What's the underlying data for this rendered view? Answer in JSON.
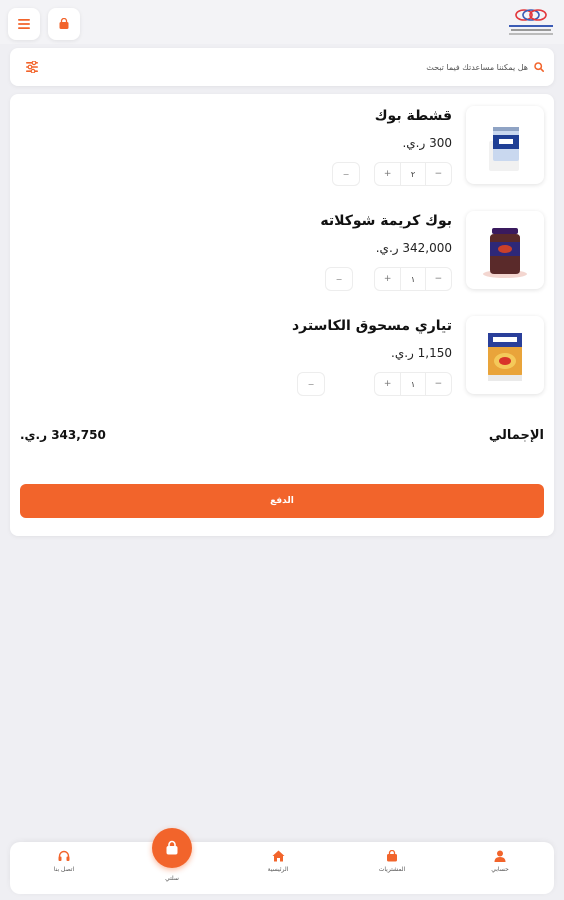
{
  "colors": {
    "accent": "#f2642b",
    "background": "#efeff3",
    "card": "#ffffff"
  },
  "header": {
    "menu_icon": "hamburger-icon",
    "cart_icon": "shopping-bag-icon",
    "logo_icon": "company-logo"
  },
  "search": {
    "placeholder": "هل يمكننا مساعدتك فيما تبحث",
    "search_icon": "search-icon",
    "filter_icon": "filter-sliders-icon"
  },
  "cart": {
    "items": [
      {
        "name": "قشطة بوك",
        "price": "300 ر.ي.",
        "quantity": "٢",
        "image_icon": "cream-can-image"
      },
      {
        "name": "بوك كريمة شوكلاته",
        "price": "342,000 ر.ي.",
        "quantity": "١",
        "image_icon": "chocolate-jar-image"
      },
      {
        "name": "تياري مسحوق الكاسترد",
        "price": "1,150 ر.ي.",
        "quantity": "١",
        "image_icon": "custard-can-image"
      }
    ],
    "total_label": "الإجمالي",
    "total_value": "343,750 ر.ي.",
    "pay_label": "الدفع"
  },
  "bottom_nav": {
    "items": [
      {
        "label": "حسابي",
        "icon": "user-icon"
      },
      {
        "label": "المشتريات",
        "icon": "purchases-bag-icon"
      },
      {
        "label": "الرئيسية",
        "icon": "home-icon"
      },
      {
        "label": "سلتي",
        "icon": "cart-bag-icon"
      },
      {
        "label": "اتصل بنا",
        "icon": "headset-icon"
      }
    ]
  }
}
